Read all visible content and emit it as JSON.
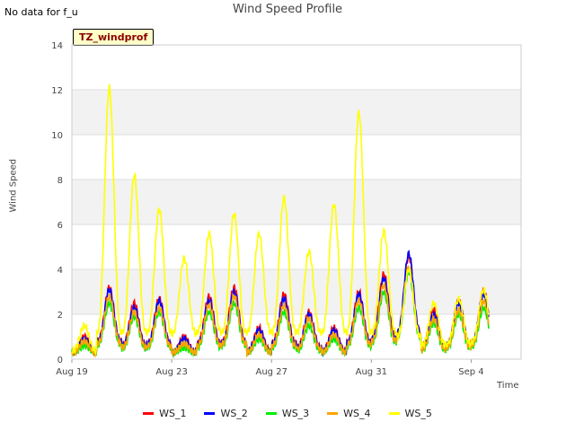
{
  "header": {
    "note": "No data for f_u",
    "site_tag": "TZ_windprof"
  },
  "chart_data": {
    "type": "line",
    "title": "Wind Speed Profile",
    "xlabel": "Time",
    "ylabel": "Wind Speed",
    "ylim": [
      0,
      14
    ],
    "yticks": [
      0,
      2,
      4,
      6,
      8,
      10,
      12,
      14
    ],
    "xlim_days": [
      "Aug 19",
      "Sep 6"
    ],
    "xticks": [
      "Aug 19",
      "Aug 23",
      "Aug 27",
      "Aug 31",
      "Sep 4"
    ],
    "grid": true,
    "legend_position": "bottom",
    "x": [
      "Aug 19",
      "Aug 20",
      "Aug 21",
      "Aug 22",
      "Aug 23",
      "Aug 24",
      "Aug 25",
      "Aug 26",
      "Aug 27",
      "Aug 28",
      "Aug 29",
      "Aug 30",
      "Aug 31",
      "Sep 1",
      "Sep 2",
      "Sep 3",
      "Sep 4",
      "Sep 5"
    ],
    "series": [
      {
        "name": "WS_1",
        "color": "#ff0000",
        "values": [
          1.0,
          3.2,
          2.5,
          2.7,
          1.0,
          2.8,
          3.2,
          1.4,
          2.9,
          2.1,
          1.4,
          3.0,
          3.8,
          4.6,
          2.2,
          2.6,
          3.0,
          2.0
        ]
      },
      {
        "name": "WS_2",
        "color": "#0000ff",
        "values": [
          0.9,
          3.1,
          2.3,
          2.6,
          0.9,
          2.6,
          3.0,
          1.3,
          2.7,
          2.0,
          1.3,
          2.9,
          3.6,
          4.7,
          2.0,
          2.5,
          2.9,
          1.9
        ]
      },
      {
        "name": "WS_3",
        "color": "#00ee00",
        "values": [
          0.6,
          2.5,
          1.9,
          2.1,
          0.5,
          2.1,
          2.5,
          0.9,
          2.1,
          1.5,
          0.9,
          2.3,
          3.0,
          3.9,
          1.6,
          2.0,
          2.3,
          1.4
        ]
      },
      {
        "name": "WS_4",
        "color": "#ffa500",
        "values": [
          0.8,
          2.8,
          2.1,
          2.3,
          0.7,
          2.4,
          2.8,
          1.1,
          2.4,
          1.8,
          1.1,
          2.6,
          3.3,
          4.1,
          1.8,
          2.2,
          2.6,
          1.6
        ]
      },
      {
        "name": "WS_5",
        "color": "#ffff00",
        "values": [
          1.5,
          12.1,
          8.2,
          6.7,
          4.5,
          5.6,
          6.5,
          5.6,
          7.2,
          4.8,
          6.9,
          11.0,
          5.7,
          4.0,
          2.5,
          2.7,
          3.1,
          2.1
        ]
      }
    ]
  }
}
